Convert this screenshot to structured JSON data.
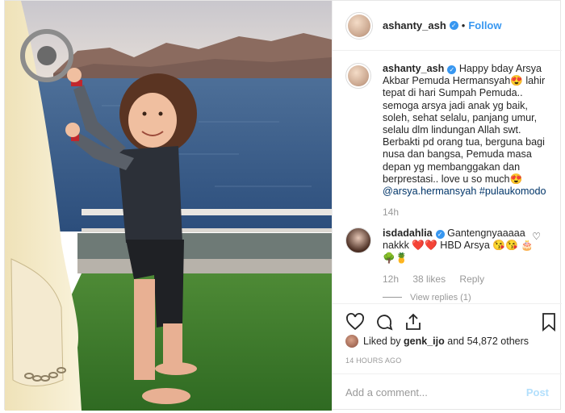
{
  "post": {
    "username": "ashanty_ash",
    "follow_label": "Follow",
    "separator": "•"
  },
  "caption": {
    "username": "ashanty_ash",
    "text": "Happy bday Arsya Akbar Pemuda Hermansyah😍 lahir tepat di hari Sumpah Pemuda.. semoga arsya jadi anak yg baik, soleh, sehat selalu, panjang umur, selalu dlm lindungan Allah swt. Berbakti pd orang tua, berguna bagi nusa dan bangsa, Pemuda masa depan yg membanggakan dan berprestasi.. love u so much😍",
    "tags": "@arsya.hermansyah #pulaukomodo",
    "time": "14h"
  },
  "comment": {
    "username": "isdadahlia",
    "text": "Gantengnyaaaaa nakkk ❤️❤️ HBD Arsya 😘😘 🎂🌳🍍",
    "time": "12h",
    "likes": "38 likes",
    "reply_label": "Reply",
    "view_replies": "View replies (1)"
  },
  "likes": {
    "text_prefix": "Liked by",
    "liker": "genk_ijo",
    "text_suffix": "and 54,872 others"
  },
  "timestamp": "14 HOURS AGO",
  "add_comment": {
    "placeholder": "Add a comment...",
    "post_label": "Post"
  },
  "icons": {
    "heart": "heart-icon",
    "comment": "comment-icon",
    "share": "share-icon",
    "save": "bookmark-icon"
  },
  "colors": {
    "link_blue": "#3897f0",
    "hashtag": "#003569",
    "muted": "#999999",
    "post_disabled": "#b2dffc",
    "sea": "#3a5f8c",
    "grass": "#3f7f2f"
  }
}
